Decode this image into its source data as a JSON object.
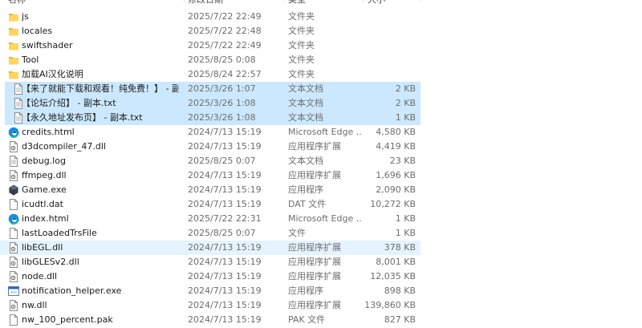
{
  "columns": {
    "name": "名称",
    "date": "修改日期",
    "type": "类型",
    "size": "大小"
  },
  "rows": [
    {
      "name": "js",
      "date": "2025/7/22 22:49",
      "type": "文件夹",
      "size": "",
      "icon": "folder-icon"
    },
    {
      "name": "locales",
      "date": "2025/7/22 22:48",
      "type": "文件夹",
      "size": "",
      "icon": "folder-icon"
    },
    {
      "name": "swiftshader",
      "date": "2025/7/22 22:49",
      "type": "文件夹",
      "size": "",
      "icon": "folder-icon"
    },
    {
      "name": "Tool",
      "date": "2025/8/25 0:08",
      "type": "文件夹",
      "size": "",
      "icon": "folder-icon"
    },
    {
      "name": "加载AI汉化说明",
      "date": "2025/8/24 22:57",
      "type": "文件夹",
      "size": "",
      "icon": "folder-icon"
    },
    {
      "name": "【来了就能下载和观看！纯免费！】 - 副...",
      "date": "2025/3/26 1:07",
      "type": "文本文档",
      "size": "2 KB",
      "icon": "text-file-icon",
      "selected": true
    },
    {
      "name": "【论坛介绍】 - 副本.txt",
      "date": "2025/3/26 1:08",
      "type": "文本文档",
      "size": "2 KB",
      "icon": "text-file-icon",
      "selected": true
    },
    {
      "name": "【永久地址发布页】 - 副本.txt",
      "date": "2025/3/26 1:08",
      "type": "文本文档",
      "size": "1 KB",
      "icon": "text-file-icon",
      "selected": true
    },
    {
      "name": "credits.html",
      "date": "2024/7/13 15:19",
      "type": "Microsoft Edge ...",
      "size": "4,580 KB",
      "icon": "edge-icon"
    },
    {
      "name": "d3dcompiler_47.dll",
      "date": "2024/7/13 15:19",
      "type": "应用程序扩展",
      "size": "4,419 KB",
      "icon": "dll-file-icon"
    },
    {
      "name": "debug.log",
      "date": "2025/8/25 0:07",
      "type": "文本文档",
      "size": "23 KB",
      "icon": "text-file-icon"
    },
    {
      "name": "ffmpeg.dll",
      "date": "2024/7/13 15:19",
      "type": "应用程序扩展",
      "size": "1,696 KB",
      "icon": "dll-file-icon"
    },
    {
      "name": "Game.exe",
      "date": "2024/7/13 15:19",
      "type": "应用程序",
      "size": "2,090 KB",
      "icon": "game-exe-icon"
    },
    {
      "name": "icudtl.dat",
      "date": "2024/7/13 15:19",
      "type": "DAT 文件",
      "size": "10,272 KB",
      "icon": "blank-file-icon"
    },
    {
      "name": "index.html",
      "date": "2025/7/22 22:31",
      "type": "Microsoft Edge ...",
      "size": "1 KB",
      "icon": "edge-icon"
    },
    {
      "name": "lastLoadedTrsFile",
      "date": "2025/8/25 0:07",
      "type": "文件",
      "size": "1 KB",
      "icon": "blank-file-icon"
    },
    {
      "name": "libEGL.dll",
      "date": "2024/7/13 15:19",
      "type": "应用程序扩展",
      "size": "378 KB",
      "icon": "dll-file-icon",
      "hover": true
    },
    {
      "name": "libGLESv2.dll",
      "date": "2024/7/13 15:19",
      "type": "应用程序扩展",
      "size": "8,001 KB",
      "icon": "dll-file-icon"
    },
    {
      "name": "node.dll",
      "date": "2024/7/13 15:19",
      "type": "应用程序扩展",
      "size": "12,035 KB",
      "icon": "dll-file-icon"
    },
    {
      "name": "notification_helper.exe",
      "date": "2024/7/13 15:19",
      "type": "应用程序",
      "size": "898 KB",
      "icon": "exe-window-icon"
    },
    {
      "name": "nw.dll",
      "date": "2024/7/13 15:19",
      "type": "应用程序扩展",
      "size": "139,860 KB",
      "icon": "dll-file-icon"
    },
    {
      "name": "nw_100_percent.pak",
      "date": "2024/7/13 15:19",
      "type": "PAK 文件",
      "size": "827 KB",
      "icon": "blank-file-icon"
    }
  ]
}
